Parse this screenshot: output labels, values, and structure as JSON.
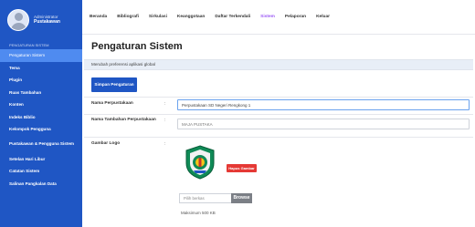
{
  "sidebar": {
    "profile": {
      "role": "Administrator",
      "name": "Pustakawan"
    },
    "section_label": "PENGATURAN SISTEM",
    "items": [
      {
        "label": "Pengaturan Sistem",
        "active": true
      },
      {
        "label": "Tema",
        "active": false
      },
      {
        "label": "Plugin",
        "active": false
      },
      {
        "label": "Ruas Tambahan",
        "active": false
      },
      {
        "label": "Konten",
        "active": false
      },
      {
        "label": "Indeks Biblio",
        "active": false
      },
      {
        "label": "Kelompok Pengguna",
        "active": false
      },
      {
        "label": "Pustakawan & Pengguna Sistem",
        "active": false
      },
      {
        "label": "Setelan Hari Libur",
        "active": false
      },
      {
        "label": "Catatan Sistem",
        "active": false
      },
      {
        "label": "Salinan Pangkalan Data",
        "active": false
      }
    ]
  },
  "topnav": {
    "items": [
      {
        "label": "Beranda",
        "active": false
      },
      {
        "label": "Bibliografi",
        "active": false
      },
      {
        "label": "Sirkulasi",
        "active": false
      },
      {
        "label": "Keanggotaan",
        "active": false
      },
      {
        "label": "Daftar Terkendali",
        "active": false
      },
      {
        "label": "Sistem",
        "active": true
      },
      {
        "label": "Pelaporan",
        "active": false
      },
      {
        "label": "Keluar",
        "active": false
      }
    ]
  },
  "main": {
    "title": "Pengaturan Sistem",
    "description": "Merubah preferensi aplikasi global",
    "save_button": "Simpan Pengaturan",
    "fields": {
      "library_name": {
        "label": "Nama Perpustakaan",
        "value": "Perpustakaan SD Negeri Rengkong 1"
      },
      "library_subname": {
        "label": "Nama Tambahan Perpustakaan",
        "placeholder": "MAJA PUSTAKA"
      },
      "logo": {
        "label": "Gambar Logo",
        "delete_button": "Hapus Gambar",
        "file_placeholder": "Pilih berkas",
        "browse_button": "Browse",
        "max_size": "Maksimum 500 KB"
      }
    },
    "colon": ":"
  },
  "colors": {
    "sidebar_bg": "#1f56c4",
    "sidebar_active": "#4f8bf0",
    "nav_active": "#9b59f5",
    "delete_red": "#e53935",
    "logo_green": "#0f8a56"
  }
}
